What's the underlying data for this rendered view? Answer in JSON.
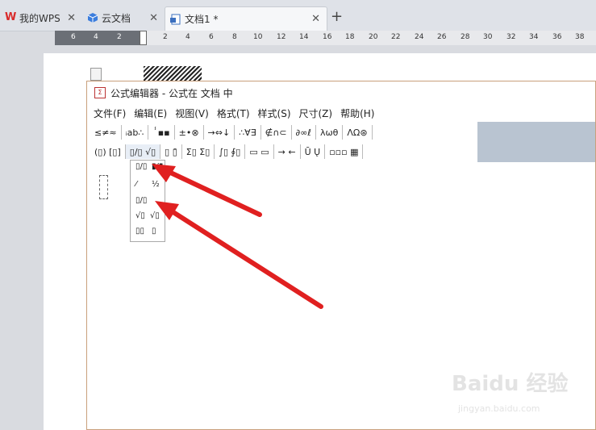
{
  "tabs": [
    {
      "label": "我的WPS",
      "close": "✕"
    },
    {
      "label": "云文档",
      "close": "✕"
    },
    {
      "label": "文档1 *",
      "close": "✕"
    }
  ],
  "new_tab": "+",
  "ruler": {
    "gray_ticks": [
      "6",
      "4",
      "2"
    ],
    "white_ticks": [
      "2",
      "4",
      "6",
      "8",
      "10",
      "12",
      "14",
      "16",
      "18",
      "20",
      "22",
      "24",
      "26",
      "28",
      "30",
      "32",
      "34",
      "36",
      "38"
    ]
  },
  "editor": {
    "title": "公式编辑器 - 公式在 文档 中",
    "app_icon": "Σ",
    "menu": [
      "文件(F)",
      "编辑(E)",
      "视图(V)",
      "格式(T)",
      "样式(S)",
      "尺寸(Z)",
      "帮助(H)"
    ],
    "toolbar_row1": [
      "≤≠≈",
      "ᵢab∴",
      "ⸯ▪▪",
      "±•⊗",
      "→⇔↓",
      "∴∀∃",
      "∉∩⊂",
      "∂∞ℓ",
      "λωθ",
      "ΛΩ⊛"
    ],
    "toolbar_row2": [
      "(▯) [▯]",
      "▯/▯ √▯",
      "▯ ▯̄",
      "Σ▯ Σ▯",
      "∫▯ ∮▯",
      "▭ ▭",
      "→ ←",
      "Ū Ų",
      "▫▫▫ ▦"
    ],
    "dropdown": [
      "▯/▯",
      "▮/▮",
      "⁄",
      "½",
      "▯/▯",
      "√▯",
      "√▯",
      "▯▯",
      "▯"
    ]
  },
  "watermark": {
    "main": "Baidu 经验",
    "sub": "jingyan.baidu.com"
  },
  "colors": {
    "arrow": "#e02020",
    "editor_border": "#c9a07c",
    "toolbar_accent": "#b9c4d1"
  }
}
